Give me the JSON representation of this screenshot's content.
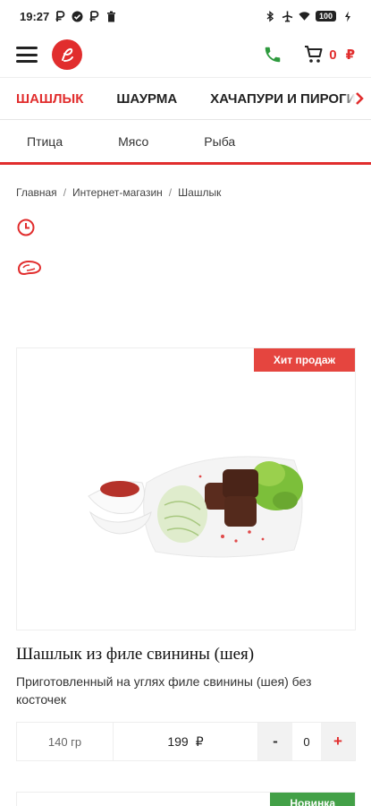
{
  "status_bar": {
    "time": "19:27",
    "battery": "100"
  },
  "header": {
    "cart_count": "0",
    "currency": "₽"
  },
  "categories": [
    {
      "label": "Шашлык",
      "active": true
    },
    {
      "label": "Шаурма",
      "active": false
    },
    {
      "label": "Хачапури и пироги",
      "active": false
    }
  ],
  "subcategories": [
    "Птица",
    "Мясо",
    "Рыба"
  ],
  "breadcrumb": [
    "Главная",
    "Интернет-магазин",
    "Шашлык"
  ],
  "breadcrumb_separator": "/",
  "product": {
    "badge": "Хит продаж",
    "title": "Шашлык из филе свинины (шея)",
    "description": "Приготовленный на углях филе свинины (шея) без косточек",
    "weight": "140 гр",
    "price": "199",
    "currency": "₽",
    "minus_label": "-",
    "quantity": "0",
    "plus_label": "+"
  },
  "next_product": {
    "badge": "Новинка"
  },
  "colors": {
    "accent": "#e12d2d",
    "badge_hit": "#e5453f",
    "badge_new": "#43a047",
    "phone": "#2e9a3e"
  }
}
